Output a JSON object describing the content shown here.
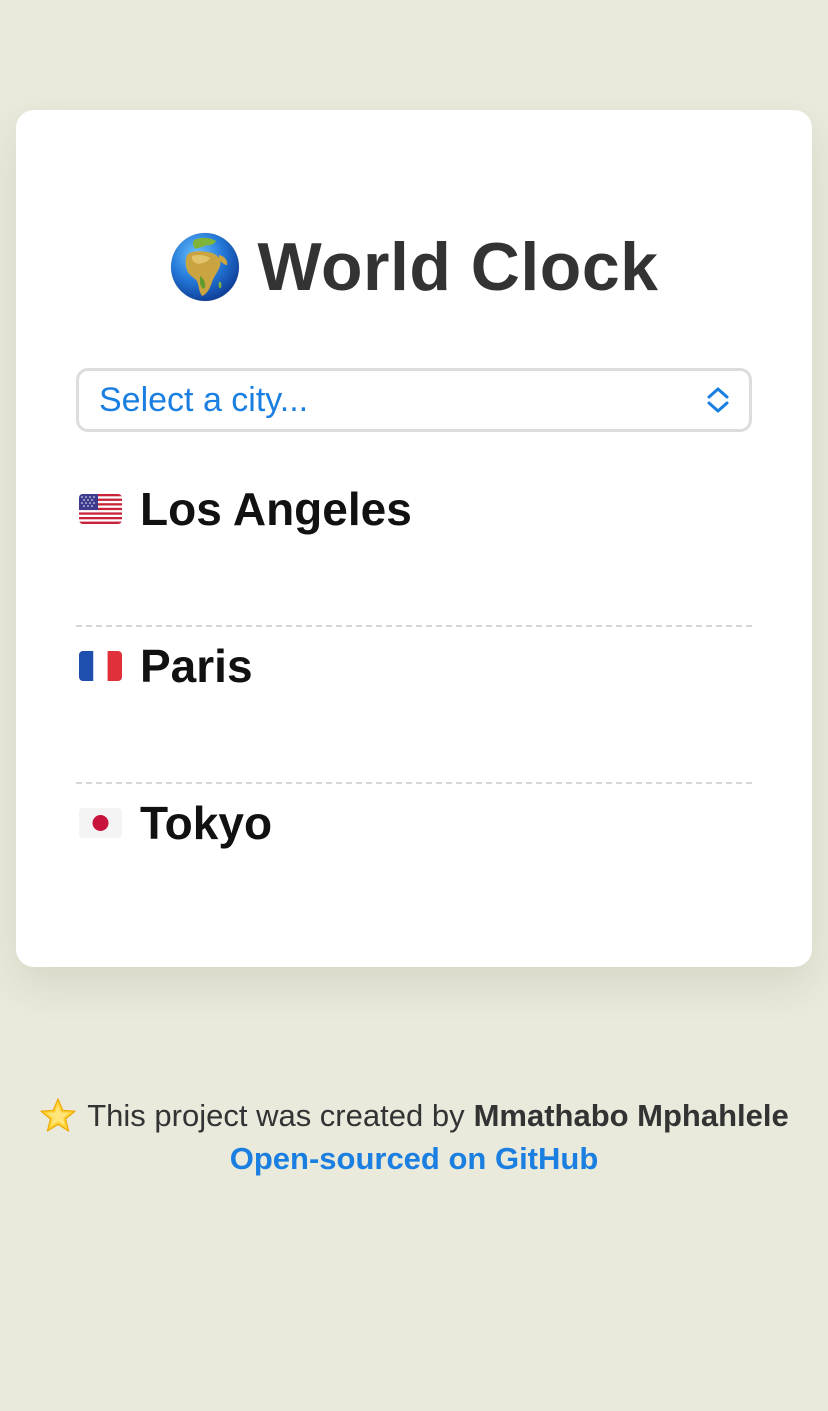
{
  "app": {
    "title": "World Clock",
    "title_icon": "globe-europe-africa-icon"
  },
  "city_select": {
    "placeholder": "Select a city...",
    "icon": "chevron-up-down-icon",
    "accent_color": "#1a7fe0"
  },
  "cities": [
    {
      "name": "Los Angeles",
      "flag_icon": "flag-us-icon"
    },
    {
      "name": "Paris",
      "flag_icon": "flag-fr-icon"
    },
    {
      "name": "Tokyo",
      "flag_icon": "flag-jp-icon"
    }
  ],
  "footer": {
    "icon": "star-icon",
    "created_text": "This project was created by",
    "author": "Mmathabo Mphahlele",
    "link_text": "Open-sourced on GitHub",
    "link_color": "#1a7fe0"
  },
  "colors": {
    "background": "#e9e9dc",
    "card": "#ffffff",
    "text": "#333333"
  }
}
